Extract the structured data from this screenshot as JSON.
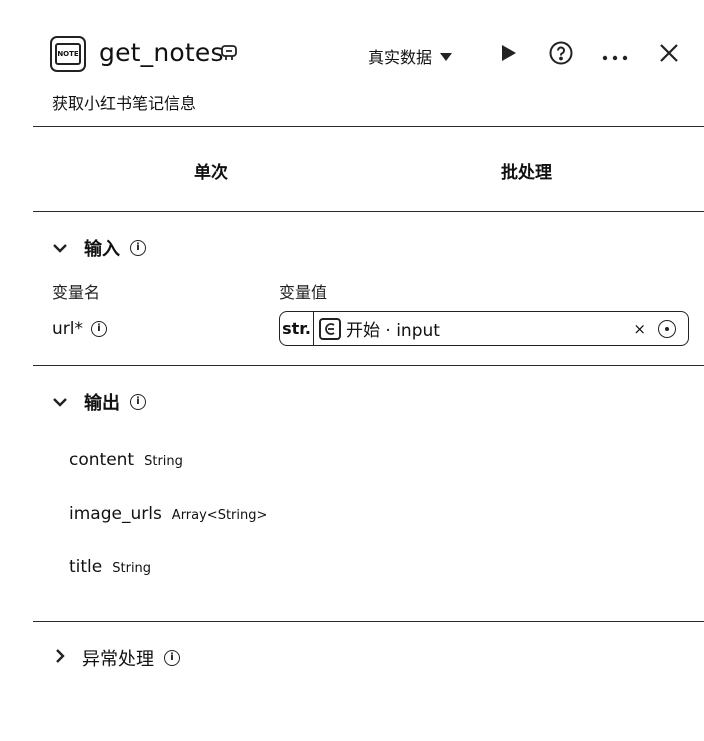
{
  "header": {
    "title": "get_notes",
    "subtitle": "获取小红书笔记信息",
    "data_mode": "真实数据",
    "app_icon_label": "NOTE"
  },
  "tabs": [
    {
      "label": "单次"
    },
    {
      "label": "批处理"
    }
  ],
  "input_section": {
    "title": "输入",
    "col_name": "变量名",
    "col_value": "变量值",
    "variables": [
      {
        "name": "url*",
        "type": "str.",
        "ref": "开始 · input",
        "clear": "×"
      }
    ]
  },
  "output_section": {
    "title": "输出",
    "fields": [
      {
        "name": "content",
        "type": "String"
      },
      {
        "name": "image_urls",
        "type": "Array<String>"
      },
      {
        "name": "title",
        "type": "String"
      }
    ]
  },
  "exception_section": {
    "title": "异常处理"
  }
}
